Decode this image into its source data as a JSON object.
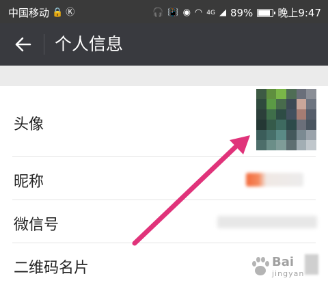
{
  "status_bar": {
    "carrier": "中国移动",
    "network": "4G",
    "battery": "89%",
    "battery_level": 0.89,
    "time": "晚上9:47"
  },
  "title_bar": {
    "title": "个人信息",
    "back_icon": "back-arrow-icon"
  },
  "rows": [
    {
      "label": "头像"
    },
    {
      "label": "昵称"
    },
    {
      "label": "微信号"
    },
    {
      "label": "二维码名片"
    }
  ],
  "watermark": {
    "text": "Bai",
    "sub": "jingyan"
  },
  "colors": {
    "status_bar": "#3a3a3a",
    "title_bar": "#393a3f",
    "section_gap": "#ebebeb",
    "arrow": "#e0337a"
  }
}
